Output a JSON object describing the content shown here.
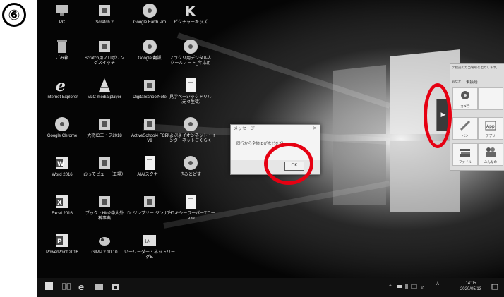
{
  "step": {
    "label": "⑥"
  },
  "desktop": {
    "icons": [
      {
        "label": "PC",
        "icon": "pc-icon"
      },
      {
        "label": "Scratch 2",
        "icon": "scratch-icon"
      },
      {
        "label": "Google Earth Pro",
        "icon": "google-earth-icon"
      },
      {
        "label": "ピクチャーキッズ",
        "icon": "picture-kids-icon"
      },
      {
        "label": "ごみ箱",
        "icon": "recycle-bin-icon"
      },
      {
        "label": "Scratch用ノロボリン\nグスイッチ",
        "icon": "app-icon"
      },
      {
        "label": "Google 翻訳",
        "icon": "disc-icon"
      },
      {
        "label": "ノラクリ用デジタル人\nクールノート_年応用",
        "icon": "disc-icon"
      },
      {
        "label": "Internet Explorer",
        "icon": "internet-explorer-icon"
      },
      {
        "label": "VLC media player",
        "icon": "vlc-icon"
      },
      {
        "label": "DigitalSchoolNote",
        "icon": "digital-school-note-icon"
      },
      {
        "label": "見学ページックドリル\n（元々生徒）",
        "icon": "document-icon"
      },
      {
        "label": "Google Chrome",
        "icon": "chrome-icon"
      },
      {
        "label": "大将ICエ・フ2018",
        "icon": "app-icon"
      },
      {
        "label": "ActiveSchool4 FCR\nV9",
        "icon": "chart-app-icon"
      },
      {
        "label": "ぷよぷよイオンネット・イ\nンターネットごくらく",
        "icon": "disc-icon"
      },
      {
        "label": "Word 2016",
        "icon": "word-icon"
      },
      {
        "label": "おってビュー（工場）",
        "icon": "camera-app-icon"
      },
      {
        "label": "AIAIスクナー",
        "icon": "document-icon"
      },
      {
        "label": "きみとどす",
        "icon": "disc-icon"
      },
      {
        "label": "Excel 2016",
        "icon": "excel-icon"
      },
      {
        "label": "ブック・Hio2中大外\n科事典",
        "icon": "app-icon"
      },
      {
        "label": "Dr.ジンプソー ジンナー",
        "icon": "app-icon"
      },
      {
        "label": "ブロキシーラーパーTコー\n.exe",
        "icon": "document-icon"
      },
      {
        "label": "PowerPoint 2016",
        "icon": "powerpoint-icon"
      },
      {
        "label": "GIMP 2.10.10",
        "icon": "gimp-icon"
      },
      {
        "label": "いーリーダー・ネットリー\nグ5.",
        "icon": "reader-icon"
      }
    ]
  },
  "dialog": {
    "title": "メッセージ",
    "close": "✕",
    "message": "同行から全体IDがなどを記",
    "ok": "OK"
  },
  "panel": {
    "title": "テ指記のた当場所を出力します。",
    "label_a": "あなた",
    "label_b": "未接続",
    "tiles": [
      {
        "label": "カメラ",
        "icon": "webcam-icon"
      },
      {
        "label": "",
        "icon": "blank-icon"
      },
      {
        "label": "ペン",
        "icon": "pen-icon"
      },
      {
        "label": "アプリ",
        "icon": "app-box-icon"
      },
      {
        "label": "ファイル",
        "icon": "books-icon"
      },
      {
        "label": "みんなの",
        "icon": "people-icon"
      }
    ],
    "toggle": "▶"
  },
  "taskbar": {
    "clock_time": "14:05",
    "clock_date": "2020/05/13",
    "tray_text": "A"
  },
  "colors": {
    "annotation": "#e60012"
  }
}
